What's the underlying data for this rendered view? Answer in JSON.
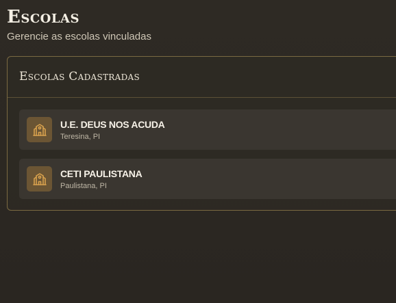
{
  "page": {
    "title": "Escolas",
    "subtitle": "Gerencie as escolas vinculadas"
  },
  "card": {
    "title": "Escolas Cadastradas"
  },
  "schools": [
    {
      "name": "U.E. DEUS NOS ACUDA",
      "location": "Teresina, PI",
      "icon": "school-building-icon"
    },
    {
      "name": "CETI PAULISTANA",
      "location": "Paulistana, PI",
      "icon": "school-building-icon"
    }
  ],
  "colors": {
    "background": "#2c2822",
    "accent_gold": "#c79a4e",
    "card_border": "#7b6a42",
    "item_background": "#3a3630",
    "icon_background": "#6b5534"
  }
}
